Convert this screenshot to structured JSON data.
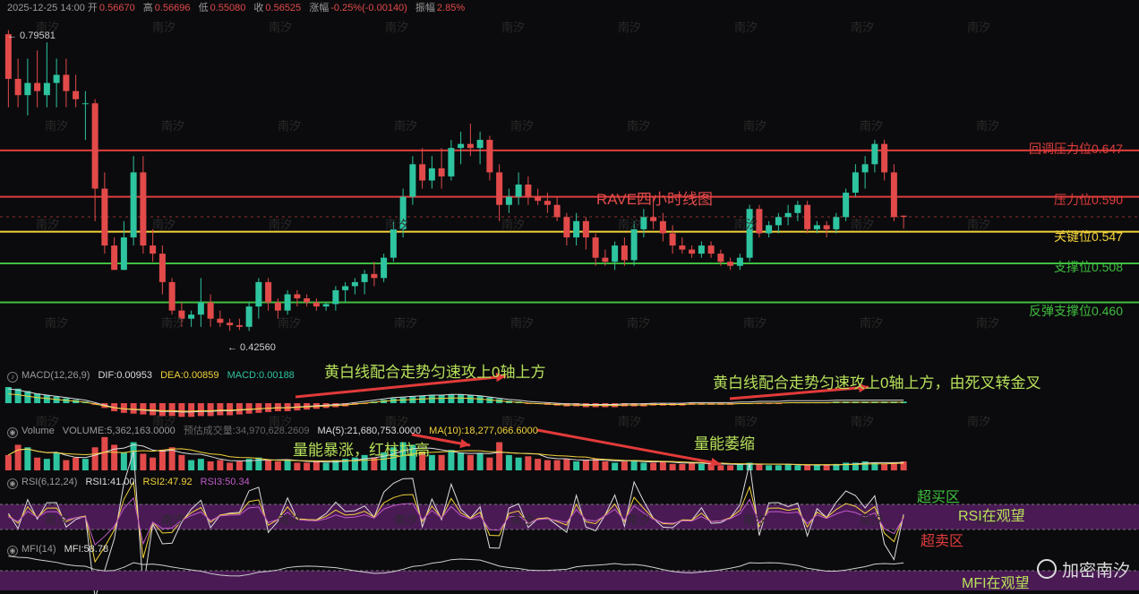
{
  "header": {
    "datetime": "2025-12-25 14:00",
    "open_label": "开",
    "open": "0.56670",
    "high_label": "高",
    "high": "0.56696",
    "low_label": "低",
    "low": "0.55080",
    "close_label": "收",
    "close": "0.56525",
    "change_label": "涨幅",
    "change": "-0.25%(-0.00140)",
    "amp_label": "振幅",
    "amp": "2.85%"
  },
  "price_marks": {
    "max_label": "← 0.79581",
    "min_label": "← 0.42560"
  },
  "chart_title": "RAVE四小时线图",
  "levels": [
    {
      "label": "回调压力位0.647",
      "price": 0.647,
      "color": "#e03c3c"
    },
    {
      "label": "压力位0.590",
      "price": 0.59,
      "color": "#e03c3c"
    },
    {
      "label": "关键位0.547",
      "price": 0.547,
      "color": "#f2d23a"
    },
    {
      "label": "支撑位0.508",
      "price": 0.508,
      "color": "#3fbf3f"
    },
    {
      "label": "反弹支撑位0.460",
      "price": 0.46,
      "color": "#3fbf3f"
    }
  ],
  "macd": {
    "title": "MACD(12,26,9)",
    "dif": "DIF:0.00953",
    "dea": "DEA:0.00859",
    "macd": "MACD:0.00188",
    "note1": "黄白线配合走势匀速攻上0轴上方",
    "note2": "黄白线配合走势匀速攻上0轴上方，由死叉转金叉"
  },
  "volume": {
    "title": "Volume",
    "vol": "VOLUME:5,362,163.0000",
    "est": "预估成交量:34,970,628.2609",
    "ma5": "MA(5):21,680,753.0000",
    "ma10": "MA(10):18,277,066.6000",
    "note1": "量能暴涨，红柱拉高",
    "note2": "量能萎缩"
  },
  "rsi": {
    "title": "RSI(6,12,24)",
    "rsi1": "RSI1:41.00",
    "rsi2": "RSI2:47.92",
    "rsi3": "RSI3:50.34",
    "overbought": "超买区",
    "note": "RSI在观望",
    "oversold": "超卖区"
  },
  "mfi": {
    "title": "MFI(14)",
    "mfi": "MFI:58.78",
    "note": "MFI在观望"
  },
  "brand": "加密南汐",
  "watermark": "南汐",
  "colors": {
    "up": "#2ec4a0",
    "down": "#e24a4a",
    "bg": "#0b0b0d",
    "yellow": "#f2d23a",
    "purple": "#4a1a55"
  },
  "chart_data": {
    "type": "candlestick",
    "ylim": [
      0.4,
      0.81
    ],
    "candles": [
      [
        0.79,
        0.795,
        0.7,
        0.735
      ],
      [
        0.735,
        0.76,
        0.7,
        0.715
      ],
      [
        0.715,
        0.76,
        0.69,
        0.73
      ],
      [
        0.73,
        0.77,
        0.7,
        0.72
      ],
      [
        0.715,
        0.78,
        0.7,
        0.73
      ],
      [
        0.73,
        0.76,
        0.7,
        0.74
      ],
      [
        0.74,
        0.76,
        0.7,
        0.72
      ],
      [
        0.72,
        0.74,
        0.7,
        0.71
      ],
      [
        0.705,
        0.72,
        0.66,
        0.705
      ],
      [
        0.705,
        0.71,
        0.56,
        0.6
      ],
      [
        0.6,
        0.62,
        0.52,
        0.53
      ],
      [
        0.53,
        0.54,
        0.5,
        0.5
      ],
      [
        0.5,
        0.56,
        0.5,
        0.54
      ],
      [
        0.54,
        0.64,
        0.53,
        0.62
      ],
      [
        0.62,
        0.64,
        0.52,
        0.53
      ],
      [
        0.53,
        0.55,
        0.51,
        0.52
      ],
      [
        0.52,
        0.53,
        0.47,
        0.485
      ],
      [
        0.485,
        0.49,
        0.445,
        0.45
      ],
      [
        0.45,
        0.46,
        0.43,
        0.44
      ],
      [
        0.44,
        0.45,
        0.43,
        0.445
      ],
      [
        0.445,
        0.49,
        0.43,
        0.46
      ],
      [
        0.46,
        0.47,
        0.43,
        0.44
      ],
      [
        0.44,
        0.45,
        0.43,
        0.435
      ],
      [
        0.435,
        0.44,
        0.425,
        0.432
      ],
      [
        0.432,
        0.44,
        0.426,
        0.43
      ],
      [
        0.43,
        0.46,
        0.425,
        0.455
      ],
      [
        0.455,
        0.49,
        0.44,
        0.485
      ],
      [
        0.485,
        0.49,
        0.45,
        0.46
      ],
      [
        0.46,
        0.465,
        0.44,
        0.45
      ],
      [
        0.45,
        0.475,
        0.445,
        0.47
      ],
      [
        0.47,
        0.475,
        0.455,
        0.465
      ],
      [
        0.465,
        0.47,
        0.455,
        0.46
      ],
      [
        0.46,
        0.465,
        0.45,
        0.455
      ],
      [
        0.455,
        0.46,
        0.45,
        0.458
      ],
      [
        0.458,
        0.48,
        0.45,
        0.475
      ],
      [
        0.475,
        0.485,
        0.46,
        0.48
      ],
      [
        0.48,
        0.49,
        0.47,
        0.485
      ],
      [
        0.485,
        0.5,
        0.47,
        0.495
      ],
      [
        0.495,
        0.51,
        0.48,
        0.49
      ],
      [
        0.49,
        0.52,
        0.485,
        0.515
      ],
      [
        0.515,
        0.56,
        0.51,
        0.55
      ],
      [
        0.55,
        0.6,
        0.54,
        0.59
      ],
      [
        0.59,
        0.64,
        0.58,
        0.63
      ],
      [
        0.63,
        0.65,
        0.6,
        0.61
      ],
      [
        0.61,
        0.64,
        0.6,
        0.625
      ],
      [
        0.625,
        0.65,
        0.6,
        0.615
      ],
      [
        0.615,
        0.66,
        0.61,
        0.65
      ],
      [
        0.65,
        0.67,
        0.63,
        0.655
      ],
      [
        0.655,
        0.68,
        0.64,
        0.65
      ],
      [
        0.65,
        0.67,
        0.63,
        0.66
      ],
      [
        0.66,
        0.665,
        0.61,
        0.62
      ],
      [
        0.62,
        0.63,
        0.56,
        0.58
      ],
      [
        0.58,
        0.6,
        0.57,
        0.59
      ],
      [
        0.59,
        0.62,
        0.58,
        0.605
      ],
      [
        0.605,
        0.615,
        0.58,
        0.59
      ],
      [
        0.59,
        0.6,
        0.58,
        0.585
      ],
      [
        0.585,
        0.595,
        0.57,
        0.58
      ],
      [
        0.58,
        0.59,
        0.56,
        0.565
      ],
      [
        0.565,
        0.57,
        0.53,
        0.54
      ],
      [
        0.54,
        0.57,
        0.53,
        0.56
      ],
      [
        0.56,
        0.565,
        0.525,
        0.54
      ],
      [
        0.54,
        0.545,
        0.505,
        0.515
      ],
      [
        0.515,
        0.525,
        0.505,
        0.51
      ],
      [
        0.51,
        0.535,
        0.5,
        0.53
      ],
      [
        0.53,
        0.54,
        0.505,
        0.512
      ],
      [
        0.512,
        0.56,
        0.505,
        0.55
      ],
      [
        0.55,
        0.575,
        0.54,
        0.565
      ],
      [
        0.565,
        0.59,
        0.55,
        0.56
      ],
      [
        0.56,
        0.57,
        0.535,
        0.545
      ],
      [
        0.545,
        0.555,
        0.52,
        0.53
      ],
      [
        0.53,
        0.54,
        0.52,
        0.525
      ],
      [
        0.525,
        0.53,
        0.515,
        0.52
      ],
      [
        0.52,
        0.535,
        0.515,
        0.53
      ],
      [
        0.53,
        0.535,
        0.515,
        0.52
      ],
      [
        0.52,
        0.525,
        0.505,
        0.51
      ],
      [
        0.51,
        0.515,
        0.5,
        0.505
      ],
      [
        0.505,
        0.52,
        0.5,
        0.515
      ],
      [
        0.515,
        0.58,
        0.51,
        0.575
      ],
      [
        0.575,
        0.58,
        0.54,
        0.545
      ],
      [
        0.545,
        0.56,
        0.54,
        0.555
      ],
      [
        0.555,
        0.57,
        0.545,
        0.565
      ],
      [
        0.565,
        0.58,
        0.555,
        0.57
      ],
      [
        0.57,
        0.585,
        0.56,
        0.58
      ],
      [
        0.58,
        0.585,
        0.545,
        0.55
      ],
      [
        0.55,
        0.56,
        0.545,
        0.555
      ],
      [
        0.555,
        0.56,
        0.54,
        0.55
      ],
      [
        0.55,
        0.57,
        0.545,
        0.565
      ],
      [
        0.565,
        0.6,
        0.56,
        0.595
      ],
      [
        0.595,
        0.63,
        0.59,
        0.62
      ],
      [
        0.62,
        0.64,
        0.6,
        0.63
      ],
      [
        0.63,
        0.66,
        0.62,
        0.655
      ],
      [
        0.655,
        0.66,
        0.61,
        0.62
      ],
      [
        0.62,
        0.63,
        0.56,
        0.565
      ],
      [
        0.5667,
        0.56696,
        0.5508,
        0.56525
      ]
    ],
    "macd_hist": [
      0.02,
      0.018,
      0.015,
      0.012,
      0.01,
      0.008,
      0.006,
      0.004,
      0.002,
      -0.002,
      -0.006,
      -0.01,
      -0.012,
      -0.013,
      -0.014,
      -0.015,
      -0.016,
      -0.016,
      -0.017,
      -0.017,
      -0.016,
      -0.016,
      -0.015,
      -0.015,
      -0.014,
      -0.013,
      -0.012,
      -0.011,
      -0.01,
      -0.01,
      -0.009,
      -0.008,
      -0.007,
      -0.006,
      -0.005,
      -0.004,
      -0.002,
      0.0,
      0.002,
      0.004,
      0.006,
      0.007,
      0.008,
      0.009,
      0.01,
      0.01,
      0.011,
      0.011,
      0.01,
      0.009,
      0.007,
      0.005,
      0.003,
      0.002,
      0.0,
      -0.001,
      -0.002,
      -0.003,
      -0.004,
      -0.004,
      -0.005,
      -0.005,
      -0.005,
      -0.005,
      -0.004,
      -0.004,
      -0.004,
      -0.003,
      -0.003,
      -0.003,
      -0.003,
      -0.002,
      -0.002,
      -0.002,
      -0.002,
      -0.002,
      -0.001,
      -0.001,
      0.0,
      0.0,
      0.0,
      0.001,
      0.001,
      0.001,
      0.001,
      0.001,
      0.002,
      0.002,
      0.002,
      0.002,
      0.002,
      0.002,
      0.002,
      0.002
    ],
    "volume": [
      12,
      20,
      18,
      10,
      9,
      14,
      8,
      10,
      9,
      18,
      26,
      20,
      14,
      22,
      13,
      10,
      16,
      18,
      12,
      8,
      9,
      7,
      8,
      6,
      7,
      9,
      10,
      8,
      7,
      8,
      6,
      6,
      7,
      6,
      8,
      9,
      10,
      12,
      10,
      14,
      18,
      22,
      20,
      14,
      12,
      12,
      16,
      14,
      12,
      13,
      10,
      22,
      12,
      10,
      11,
      9,
      8,
      8,
      9,
      7,
      8,
      9,
      7,
      6,
      7,
      8,
      6,
      6,
      7,
      5,
      5,
      6,
      5,
      5,
      4,
      4,
      5,
      6,
      5,
      4,
      4,
      5,
      4,
      4,
      4,
      4,
      5,
      6,
      6,
      7,
      6,
      5,
      6,
      7
    ]
  }
}
